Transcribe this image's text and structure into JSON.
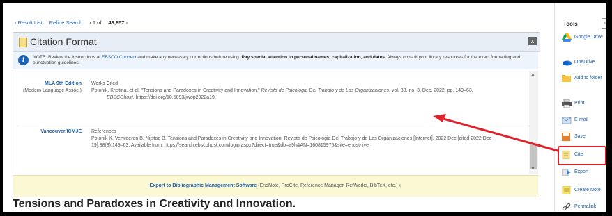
{
  "nav": {
    "result_list": "‹ Result List",
    "refine_search": "Refine Search",
    "count_prefix": "‹ 1 of",
    "count_total": "48,857",
    "count_suffix": "›"
  },
  "panel": {
    "title": "Citation Format",
    "close": "x",
    "note": {
      "part1": "NOTE: Review the instructions at",
      "link": "EBSCO Connect",
      "part2": "and make any necessary corrections before using.",
      "bold": "Pay special attention to personal names, capitalization, and dates.",
      "part3": "Always consult your library resources for the exact formatting and punctuation guidelines."
    },
    "citations": [
      {
        "format": "MLA 9th Edition",
        "format_sub": "(Modern Language Assoc.)",
        "heading": "Works Cited",
        "text1": "Potonik, Kristina, et al. \"Tensions and Paradoxes in Creativity and Innovation.\"",
        "journal": "Revista de Psicologia Del Trabajo y de Las Organizaciones",
        "text2": ", vol. 38, no. 3, Dec. 2022, pp. 149–63.",
        "source": "EBSCOhost",
        "text3": ", https://doi.org/10.5093/jwop2022a19."
      },
      {
        "format": "Vancouver/ICMJE",
        "format_sub": "",
        "heading": "References",
        "text1": "Potonik K, Verwaeren B, Nijstad B. Tensions and Paradoxes in Creativity and Innovation. Revista de Psicologia Del Trabajo y de Las Organizaciones [Internet]. 2022 Dec [cited 2022 Dec 19];38(3):149–63. Available from: https://search.ebscohost.com/login.aspx?direct=true&db=a9h&AN=160815975&site=ehost-live"
      }
    ],
    "export": {
      "link": "Export to Bibliographic Management Software",
      "rest": "(EndNote, ProCite, Reference Manager, RefWorks, BibTeX, etc.) »"
    }
  },
  "article_title": {
    "part1": "Tensions and Paradoxes in",
    "highlight": "Creativity",
    "part2": "and Innovation."
  },
  "sidebar": {
    "title": "Tools",
    "collapse": "»",
    "tools": [
      {
        "label": "Google Drive",
        "icon": "google-drive-icon"
      },
      {
        "label": "OneDrive",
        "icon": "onedrive-icon"
      },
      {
        "label": "Add to folder",
        "icon": "folder-icon"
      },
      {
        "label": "Print",
        "icon": "printer-icon"
      },
      {
        "label": "E-mail",
        "icon": "email-icon"
      },
      {
        "label": "Save",
        "icon": "save-icon"
      },
      {
        "label": "Cite",
        "icon": "cite-icon"
      },
      {
        "label": "Export",
        "icon": "export-icon"
      },
      {
        "label": "Create Note",
        "icon": "note-icon"
      },
      {
        "label": "Permalink",
        "icon": "link-icon"
      }
    ]
  },
  "colors": {
    "link": "#1f5fa8",
    "highlight": "#e0202a",
    "export_bg": "#fbf8d4"
  }
}
